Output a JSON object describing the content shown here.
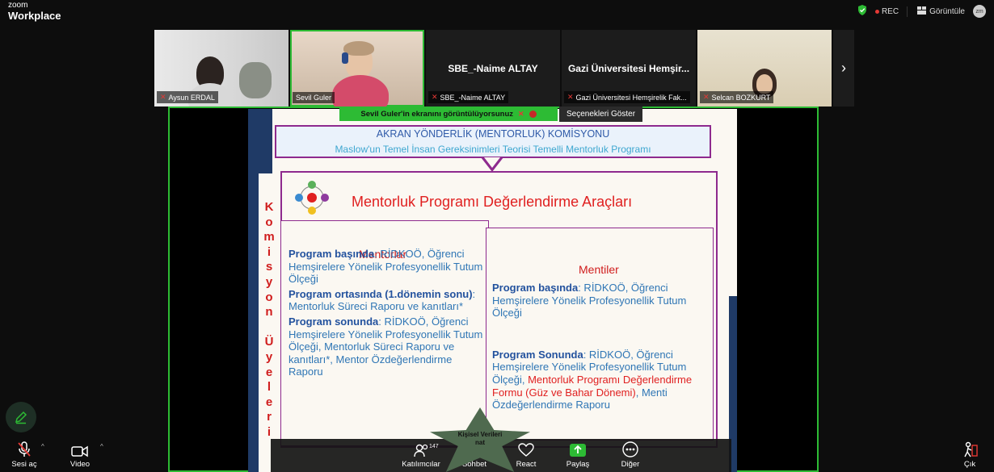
{
  "app": {
    "brand_small": "zoom",
    "brand_large": "Workplace"
  },
  "topbar": {
    "rec_label": "REC",
    "view_label": "Görüntüle",
    "avatar_initials": "zm"
  },
  "participants": [
    {
      "name": "Aysun ERDAL",
      "muted": true,
      "video": true
    },
    {
      "name": "Sevil Guler",
      "muted": false,
      "video": true,
      "active_speaker": true
    },
    {
      "name": "SBE_-Naime ALTAY",
      "display_title": "SBE_-Naime ALTAY",
      "muted": true,
      "video": false
    },
    {
      "name": "Gazi Üniversitesi Hemşirelik Fak...",
      "display_title": "Gazi Üniversitesi Hemşir...",
      "muted": true,
      "video": false
    },
    {
      "name": "Selcan BOZKURT",
      "muted": true,
      "video": true
    }
  ],
  "share": {
    "banner_text": "Sevil Guler'in ekranını görüntülüyorsunuz",
    "options_label": "Seçenekleri Göster"
  },
  "slide": {
    "header_line1": "AKRAN YÖNDERLİK (MENTORLUK) KOMİSYONU",
    "header_line2": "Maslow'un Temel İnsan Gereksinimleri Teorisi Temelli Mentorluk Programı",
    "title": "Mentorluk Programı Değerlendirme Araçları",
    "side_letters": [
      "K",
      "o",
      "m",
      "i",
      "s",
      "y",
      "o",
      "n",
      " ",
      "Ü",
      "y",
      "e",
      "l",
      "e",
      "r",
      "i"
    ],
    "mentors": {
      "heading": "Mentorlar",
      "p1_bold": "Program başında",
      "p1_text": ": RİDKOÖ, Öğrenci Hemşirelere Yönelik Profesyonellik Tutum Ölçeği",
      "p2_bold": "Program ortasında (1.dönemin sonu)",
      "p2_text": ": Mentorluk Süreci Raporu ve kanıtları*",
      "p3_bold": "Program sonunda",
      "p3_text": ": RİDKOÖ, Öğrenci Hemşirelere Yönelik Profesyonellik Tutum Ölçeği, Mentorluk Süreci Raporu ve kanıtları*, Mentor Özdeğerlendirme Raporu"
    },
    "mentees": {
      "heading": "Mentiler",
      "p1_bold": "Program başında",
      "p1_text": ": RİDKOÖ, Öğrenci Hemşirelere Yönelik Profesyonellik Tutum Ölçeği",
      "p2_bold": "Program Sonunda",
      "p2_text": ": RİDKOÖ, Öğrenci Hemşirelere Yönelik Profesyonellik Tutum Ölçeği, ",
      "p2_red": "Mentorluk Programı Değerlendirme Formu (Güz ve Bahar Dönemi)",
      "p2_tail": ", Menti Özdeğerlendirme Raporu"
    },
    "star_text": "Kişisel Verileri",
    "star_text2": "nat"
  },
  "controls": {
    "audio": "Sesi aç",
    "video": "Video",
    "participants": "Katılımcılar",
    "participants_count": "147",
    "chat": "Sohbet",
    "react": "React",
    "share": "Paylaş",
    "more": "Diğer",
    "leave": "Çık"
  },
  "colors": {
    "accent_green": "#2dbb34",
    "slide_red": "#e02020",
    "slide_blue": "#2f76b5",
    "slide_purple": "#8e2a8e"
  }
}
